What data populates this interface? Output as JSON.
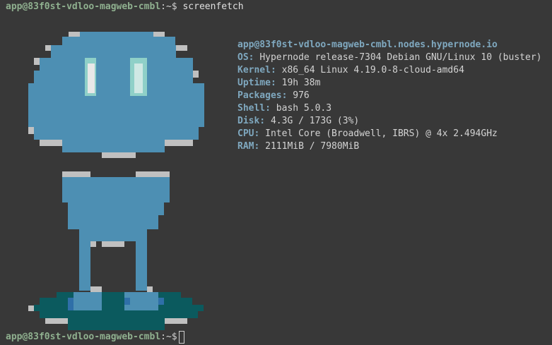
{
  "colors": {
    "background": "#383838",
    "prompt_user": "#8fb08f",
    "info_key": "#7fa8bf",
    "text": "#d3d3d3",
    "logo_body": "#4d8fb3",
    "logo_outline": "#c0c0c0",
    "logo_eye": "#8fd0c8",
    "logo_ground": "#0b5a5e"
  },
  "prompt": {
    "user_host": "app@83f0st-vdloo-magweb-cmbl",
    "path": ":~$",
    "command": "screenfetch"
  },
  "prompt2": {
    "user_host": "app@83f0st-vdloo-magweb-cmbl",
    "path": ":~$"
  },
  "info": {
    "title": "app@83f0st-vdloo-magweb-cmbl.nodes.hypernode.io",
    "rows": [
      {
        "key": "OS:",
        "value": "Hypernode release-7304 Debian GNU/Linux 10 (buster)"
      },
      {
        "key": "Kernel:",
        "value": "x86_64 Linux 4.19.0-8-cloud-amd64"
      },
      {
        "key": "Uptime:",
        "value": "19h 38m"
      },
      {
        "key": "Packages:",
        "value": "976"
      },
      {
        "key": "Shell:",
        "value": "bash 5.0.3"
      },
      {
        "key": "Disk:",
        "value": "4.3G / 173G (3%)"
      },
      {
        "key": "CPU:",
        "value": "Intel Core (Broadwell, IBRS) @ 4x 2.494GHz"
      },
      {
        "key": "RAM:",
        "value": "2111MiB / 7980MiB"
      }
    ]
  },
  "logo": {
    "icon": "hypernode-robot-logo"
  }
}
